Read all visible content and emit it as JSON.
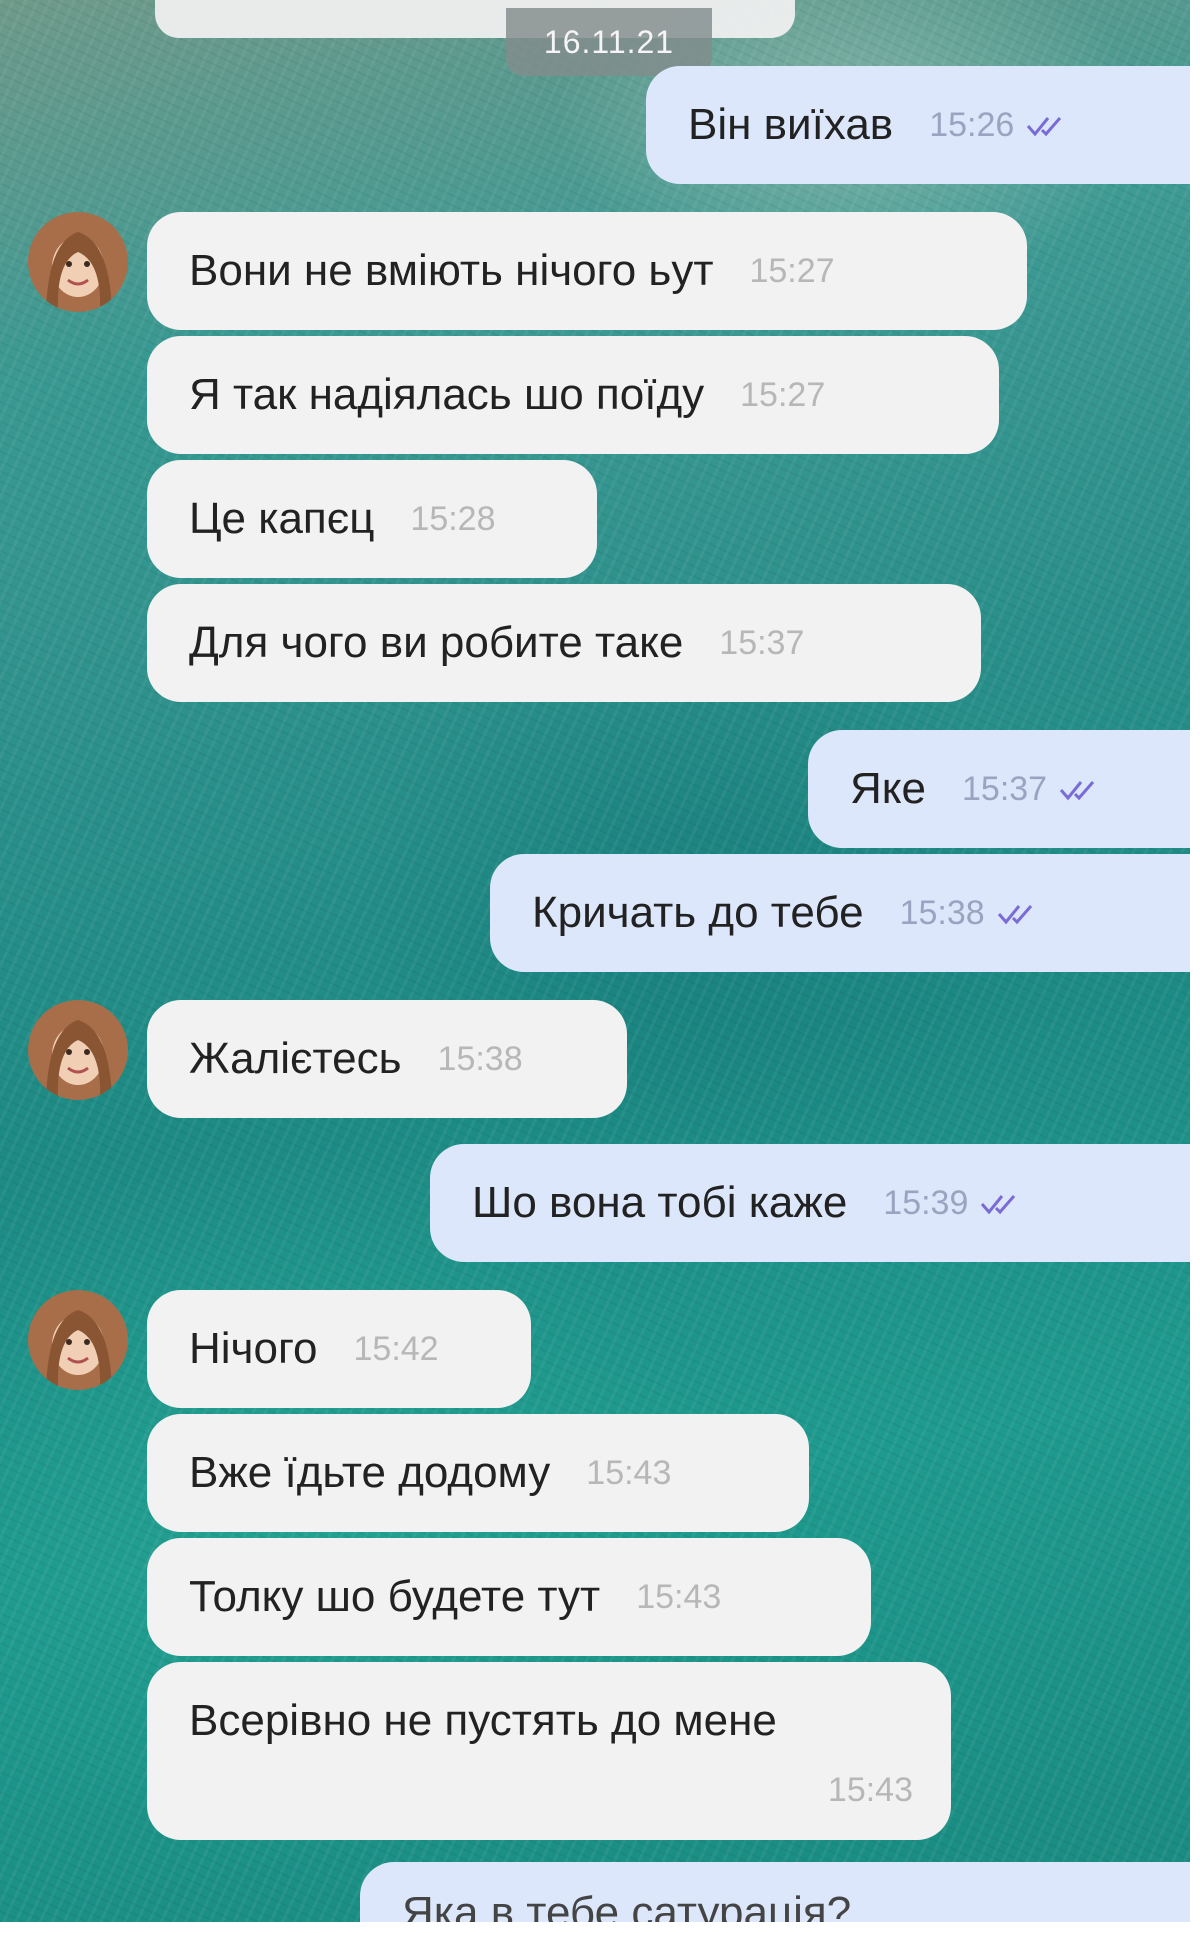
{
  "chat": {
    "date": "16.11.21",
    "messages": [
      {
        "dir": "out",
        "text": "Він виїхав",
        "time": "15:26"
      },
      {
        "dir": "in",
        "text": "Вони не вміють нічого ьут",
        "time": "15:27"
      },
      {
        "dir": "in",
        "text": "Я так надіялась шо поїду",
        "time": "15:27"
      },
      {
        "dir": "in",
        "text": "Це капєц",
        "time": "15:28"
      },
      {
        "dir": "in",
        "text": "Для чого ви робите таке",
        "time": "15:37"
      },
      {
        "dir": "out",
        "text": "Яке",
        "time": "15:37"
      },
      {
        "dir": "out",
        "text": "Кричать до тебе",
        "time": "15:38"
      },
      {
        "dir": "in",
        "text": "Жалієтесь",
        "time": "15:38"
      },
      {
        "dir": "out",
        "text": "Шо вона тобі каже",
        "time": "15:39"
      },
      {
        "dir": "in",
        "text": "Нічого",
        "time": "15:42"
      },
      {
        "dir": "in",
        "text": "Вже їдьте додому",
        "time": "15:43"
      },
      {
        "dir": "in",
        "text": "Толку шо будете тут",
        "time": "15:43"
      },
      {
        "dir": "in",
        "text": "Всерівно не пустять до мене",
        "time": "15:43"
      },
      {
        "dir": "out",
        "text": "Яка в тебе сатурація?",
        "time": ""
      }
    ]
  },
  "icons": {
    "read_receipt": "double-check-icon",
    "contact_avatar": "avatar"
  },
  "colors": {
    "incoming_bubble": "#f2f2f2",
    "outgoing_bubble": "#dce7fb",
    "ticks": "#7a6bd6"
  }
}
